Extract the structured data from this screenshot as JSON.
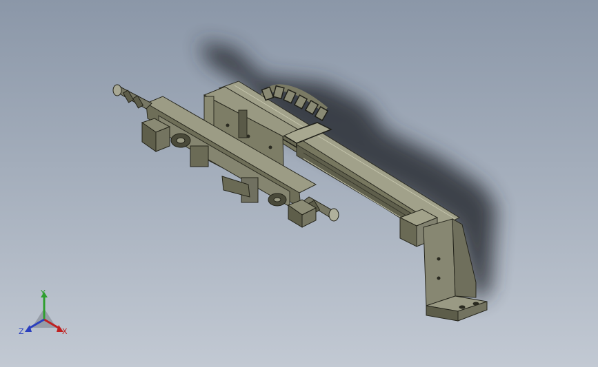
{
  "viewport": {
    "background_top": "#8b97a8",
    "background_bottom": "#c2c9d3",
    "part_color": "#8e8e78"
  },
  "triad": {
    "labels": {
      "x": "X",
      "y": "Y",
      "z": "Z"
    },
    "colors": {
      "x": "#c02020",
      "y": "#2f9f2f",
      "z": "#2a3fbf"
    }
  }
}
